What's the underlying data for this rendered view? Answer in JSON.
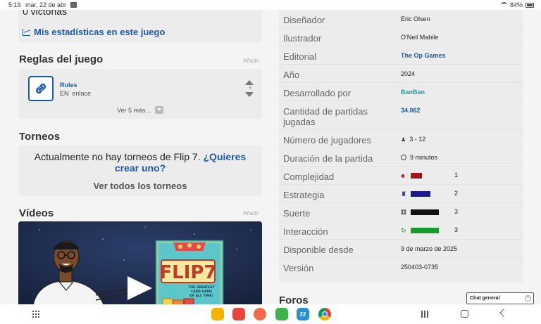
{
  "status_bar": {
    "time": "5:19",
    "date": "mar, 22 de abr",
    "battery": "84%"
  },
  "left": {
    "victories_text": "0 victorias",
    "stats_link": "Mis estadísticas en este juego",
    "rules_section": {
      "title": "Reglas del juego",
      "add_label": "Añadir",
      "rule_name": "Rules",
      "rule_lang": "EN",
      "rule_type": "enlace",
      "vote_count": "5",
      "more_label": "Ver 5 más..."
    },
    "tournaments": {
      "title": "Torneos",
      "text": "Actualmente no hay torneos de Flip 7.",
      "create_link": "¿Quieres crear uno?",
      "see_all": "Ver todos los torneos"
    },
    "videos": {
      "title": "Vídeos",
      "add_label": "Añadir",
      "box_title": "FLIP7",
      "box_subtitle": "THE GREATEST CARD GAME OF ALL TIME!"
    }
  },
  "right": {
    "info": [
      {
        "label": "Diseñador",
        "value": "Eric Olsen"
      },
      {
        "label": "Ilustrador",
        "value": "O'Neil Mabile"
      },
      {
        "label": "Editorial",
        "value": "The Op Games"
      },
      {
        "label": "Año",
        "value": "2024"
      },
      {
        "label": "Desarrollado por",
        "value": "BanBan"
      },
      {
        "label": "Cantidad de partidas jugadas",
        "value": "34.062"
      },
      {
        "label": "Número de jugadores",
        "value": "3 - 12"
      },
      {
        "label": "Duración de la partida",
        "value": "9 minutos"
      },
      {
        "label": "Complejidad",
        "value": "1"
      },
      {
        "label": "Estrategia",
        "value": "2"
      },
      {
        "label": "Suerte",
        "value": "3"
      },
      {
        "label": "Interacción",
        "value": "3"
      },
      {
        "label": "Disponible desde",
        "value": "9 de marzo de 2025"
      },
      {
        "label": "Versión",
        "value": "250403-0735"
      }
    ],
    "ratings": {
      "complexity": {
        "value": 1,
        "max": 5,
        "color": "#a01818"
      },
      "strategy": {
        "value": 2,
        "max": 5,
        "color": "#1a1a8a"
      },
      "luck": {
        "value": 3,
        "max": 5,
        "color": "#111111"
      },
      "interaction": {
        "value": 3,
        "max": 5,
        "color": "#1a9a2a"
      }
    },
    "forums_title": "Foros",
    "chat_label": "Chat general"
  },
  "colors": {
    "link_blue": "#1a5aa8",
    "teal": "#1aa1a1",
    "card_bg": "#ececec"
  },
  "dock_apps": [
    "files-icon",
    "notes-icon",
    "contacts-icon",
    "calculator-icon",
    "calendar-icon",
    "chrome-icon"
  ],
  "calendar_day": "22"
}
